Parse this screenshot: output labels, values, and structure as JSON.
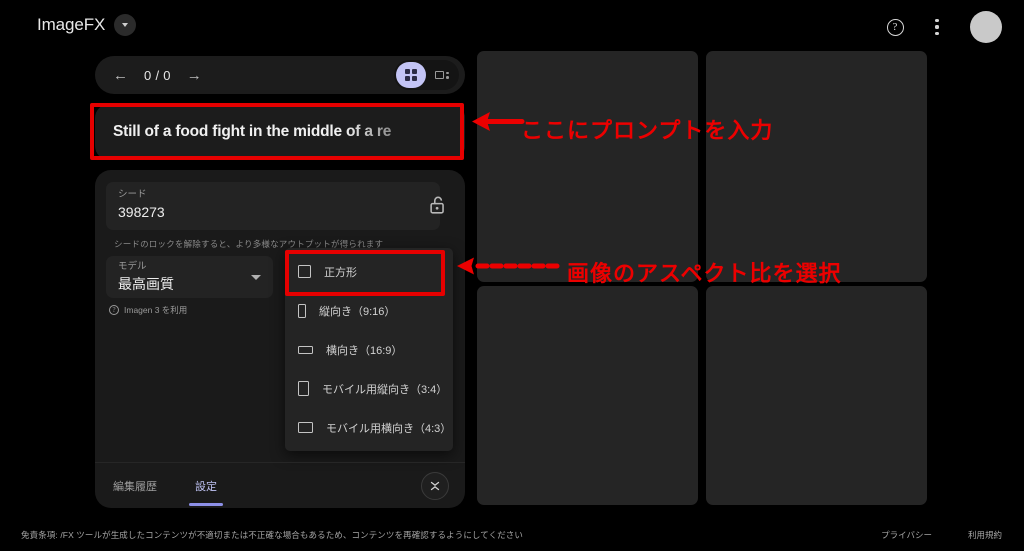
{
  "app": {
    "brand": "ImageFX",
    "brand_badge_icon": "caret-down-icon"
  },
  "topbar": {
    "help_icon": "help-circle-icon",
    "help_glyph": "?",
    "more_icon": "kebab-menu-icon",
    "avatar_icon": "user-avatar"
  },
  "nav": {
    "prev_icon": "arrow-left-icon",
    "prev_glyph": "←",
    "next_icon": "arrow-right-icon",
    "next_glyph": "→",
    "counter": "0 / 0",
    "view_grid_icon": "grid-view-icon",
    "view_split_icon": "split-view-icon",
    "active_view": "grid"
  },
  "prompt": {
    "value": "Still of a food fight in the middle of a re",
    "placeholder": "Still of a food fight in the middle of a re"
  },
  "settings": {
    "seed": {
      "label": "シード",
      "value": "398273",
      "lock_icon": "unlocked-padlock-icon",
      "hint": "シードのロックを解除すると、より多様なアウトプットが得られます"
    },
    "model": {
      "label": "モデル",
      "value": "最高画質",
      "caret_icon": "chevron-down-icon",
      "note": "Imagen 3 を利用",
      "note_icon": "info-circle-icon"
    },
    "aspect_ratio_menu": [
      {
        "label": "正方形",
        "icon": "square-icon",
        "shape": "ar-sq",
        "selected": true
      },
      {
        "label": "縦向き（9:16）",
        "icon": "portrait-icon",
        "shape": "ar-port",
        "selected": false
      },
      {
        "label": "横向き（16:9）",
        "icon": "landscape-icon",
        "shape": "ar-land",
        "selected": false
      },
      {
        "label": "モバイル用縦向き（3:4）",
        "icon": "mobile-portrait-icon",
        "shape": "ar-mport",
        "selected": false
      },
      {
        "label": "モバイル用横向き（4:3）",
        "icon": "mobile-landscape-icon",
        "shape": "ar-mland",
        "selected": false
      }
    ],
    "tabs": [
      {
        "label": "編集履歴",
        "active": false
      },
      {
        "label": "設定",
        "active": true
      }
    ],
    "collapse_icon": "collapse-chevrons-icon"
  },
  "gallery": {
    "tiles": [
      {
        "name": "image-tile-1"
      },
      {
        "name": "image-tile-2"
      },
      {
        "name": "image-tile-3"
      },
      {
        "name": "image-tile-4"
      }
    ]
  },
  "footer": {
    "disclaimer": "免責条項: /FX ツールが生成したコンテンツが不適切または不正確な場合もあるため、コンテンツを再確認するようにしてください",
    "links": [
      {
        "label": "プライバシー"
      },
      {
        "label": "利用規約"
      }
    ]
  },
  "annotations": [
    {
      "id": "prompt",
      "text": "ここにプロンプトを入力",
      "arrow": "arrow-left-solid"
    },
    {
      "id": "aspect",
      "text": "画像のアスペクト比を選択",
      "arrow": "arrow-left-dashed"
    }
  ],
  "colors": {
    "background": "#000000",
    "panel": "#1a1a1a",
    "field": "#232323",
    "tile": "#252525",
    "accent": "#c3c4f5",
    "accent_underline": "#8d90e8",
    "annotation_red": "#e60000"
  }
}
